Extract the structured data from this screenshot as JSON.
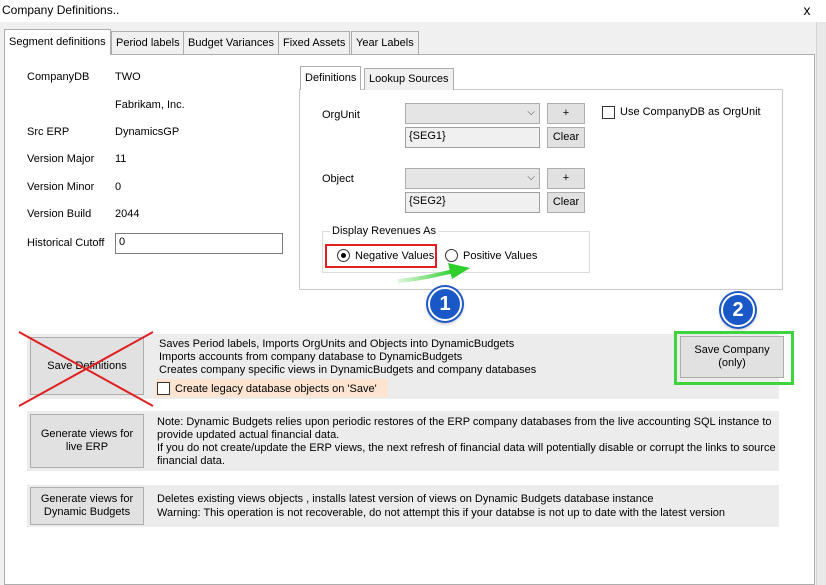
{
  "window": {
    "title": "Company Definitions..",
    "close_glyph": "x"
  },
  "tabs": [
    "Segment definitions",
    "Period labels",
    "Budget Variances",
    "Fixed Assets",
    "Year Labels"
  ],
  "info": {
    "companydb_label": "CompanyDB",
    "companydb_value": "TWO",
    "company_name": "Fabrikam, Inc.",
    "src_erp_label": "Src ERP",
    "src_erp_value": "DynamicsGP",
    "version_major_label": "Version Major",
    "version_major_value": "11",
    "version_minor_label": "Version Minor",
    "version_minor_value": "0",
    "version_build_label": "Version Build",
    "version_build_value": "2044",
    "historical_cutoff_label": "Historical Cutoff",
    "historical_cutoff_value": "0"
  },
  "definitions": {
    "tabs": [
      "Definitions",
      "Lookup Sources"
    ],
    "orgunit_label": "OrgUnit",
    "orgunit_selected": "",
    "orgunit_segment": "{SEG1}",
    "object_label": "Object",
    "object_selected": "",
    "object_segment": "{SEG2}",
    "add_label": "+",
    "clear_label": "Clear",
    "use_companydb_label": "Use CompanyDB as OrgUnit",
    "display_revenues_label": "Display Revenues As",
    "negative_values_label": "Negative Values",
    "positive_values_label": "Positive Values"
  },
  "actions": {
    "save_definitions_label": "Save Definitions",
    "save_definitions_desc": [
      "Saves Period labels, Imports OrgUnits and Objects into DynamicBudgets",
      "Imports accounts from company database to DynamicBudgets",
      "Creates company specific views in DynamicBudgets and company databases"
    ],
    "legacy_checkbox_label": "Create legacy database objects on 'Save'",
    "save_company_label_1": "Save Company",
    "save_company_label_2": "(only)",
    "gen_erp_label_1": "Generate views for",
    "gen_erp_label_2": "live ERP",
    "gen_erp_desc": [
      "Note: Dynamic Budgets relies upon periodic restores of the ERP company databases from the live accounting SQL instance to",
      "provide updated actual financial data.",
      "If you do not create/update the ERP views, the next refresh of financial data will potentially disable or corrupt the links to source",
      "financial data."
    ],
    "gen_db_label_1": "Generate views for",
    "gen_db_label_2": "Dynamic Budgets",
    "gen_db_desc": [
      "Deletes existing views objects , installs latest version of views on Dynamic Budgets database instance",
      "Warning: This operation is not recoverable, do not attempt this if your databse is not up to date with the latest version"
    ]
  },
  "annotations": {
    "badge_1": "1",
    "badge_2": "2"
  },
  "colors": {
    "annotation_red": "#e02020",
    "annotation_green": "#3dd43d",
    "badge_blue": "#1b58c7",
    "legacy_highlight": "#fce4d0"
  }
}
